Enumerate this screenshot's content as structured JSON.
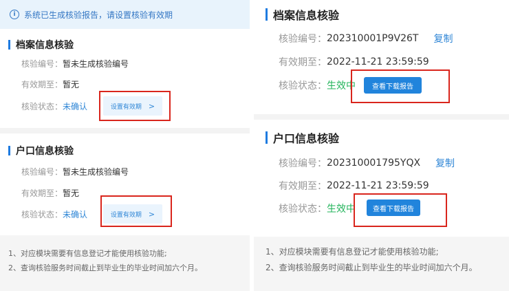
{
  "notice": {
    "icon": "info-circle-icon",
    "text": "系统已生成核验报告，请设置核验有效期"
  },
  "left": {
    "archive": {
      "title": "档案信息核验",
      "number_label": "核验编号：",
      "number_value": "暂未生成核验编号",
      "expiry_label": "有效期至：",
      "expiry_value": "暂无",
      "status_label": "核验状态：",
      "status_value": "未确认",
      "button": "设置有效期",
      "button_icon": "chevron-right-icon"
    },
    "household": {
      "title": "户口信息核验",
      "number_label": "核验编号：",
      "number_value": "暂未生成核验编号",
      "expiry_label": "有效期至：",
      "expiry_value": "暂无",
      "status_label": "核验状态：",
      "status_value": "未确认",
      "button": "设置有效期",
      "button_icon": "chevron-right-icon"
    },
    "notes": [
      "1、对应模块需要有信息登记才能使用核验功能;",
      "2、查询核验服务时间截止到毕业生的毕业时间加六个月。"
    ]
  },
  "right": {
    "archive": {
      "title": "档案信息核验",
      "number_label": "核验编号：",
      "number_value": "202310001P9V26T",
      "copy": "复制",
      "expiry_label": "有效期至：",
      "expiry_value": "2022-11-21 23:59:59",
      "status_label": "核验状态：",
      "status_value": "生效中",
      "button": "查看下载报告"
    },
    "household": {
      "title": "户口信息核验",
      "number_label": "核验编号：",
      "number_value": "202310001795YQX",
      "copy": "复制",
      "expiry_label": "有效期至：",
      "expiry_value": "2022-11-21 23:59:59",
      "status_label": "核验状态：",
      "status_value": "生效中",
      "button": "查看下载报告"
    },
    "notes": [
      "1、对应模块需要有信息登记才能使用核验功能;",
      "2、查询核验服务时间截止到毕业生的毕业时间加六个月。"
    ]
  },
  "colors": {
    "accent": "#2184dc",
    "annotation_red": "#d9251c",
    "status_valid": "#21b35a",
    "status_pending": "#2f86d6"
  }
}
